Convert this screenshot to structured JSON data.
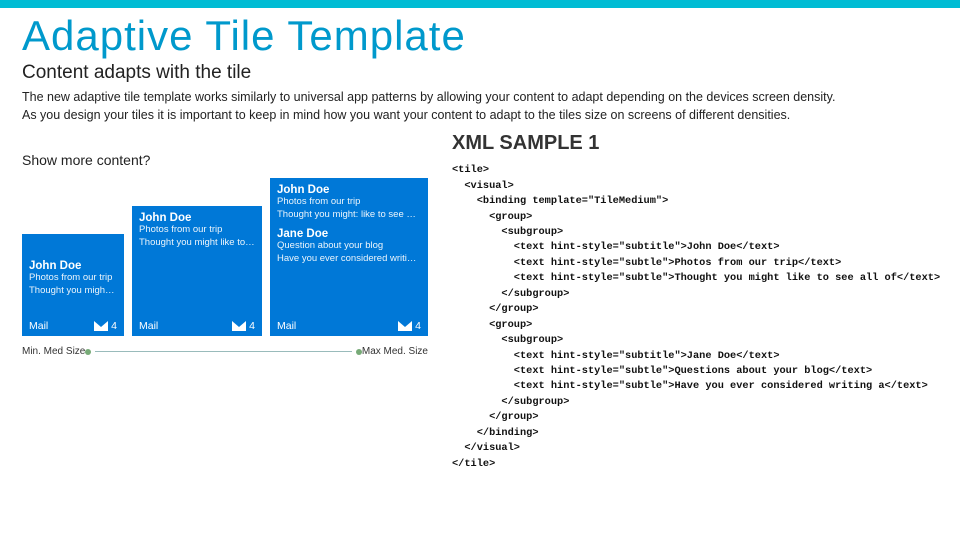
{
  "title": "Adaptive Tile Template",
  "subtitle": "Content adapts with the tile",
  "description": "The new adaptive tile template works similarly to universal app patterns by allowing your content to adapt depending on the devices screen density.\nAs you design your tiles it is important to keep in mind how you want your content to adapt to the tiles size on screens of different densities.",
  "showMore": "Show more content?",
  "xmlHeading": "XML SAMPLE 1",
  "sizer": {
    "min": "Min. Med Size",
    "max": "Max Med. Size"
  },
  "tiles": {
    "app": "Mail",
    "badge4": "4",
    "badge2a": "4",
    "badge2b": "4",
    "msgs": [
      {
        "name": "John Doe",
        "l1": "Photos from our trip",
        "l2": "Thought you might like to"
      },
      {
        "name": "John Doe",
        "l1": "Photos from our trip",
        "l2": "Thought you might like to see"
      },
      {
        "name": "John Doe",
        "l1": "Photos from our trip",
        "l2": "Thought you might: like to see all o"
      },
      {
        "name": "Jane Doe",
        "l1": "Question about your blog",
        "l2": "Have you ever considered writing a"
      }
    ]
  },
  "xml": "<tile>\n  <visual>\n    <binding template=\"TileMedium\">\n      <group>\n        <subgroup>\n          <text hint-style=\"subtitle\">John Doe</text>\n          <text hint-style=\"subtle\">Photos from our trip</text>\n          <text hint-style=\"subtle\">Thought you might like to see all of</text>\n        </subgroup>\n      </group>\n      <group>\n        <subgroup>\n          <text hint-style=\"subtitle\">Jane Doe</text>\n          <text hint-style=\"subtle\">Questions about your blog</text>\n          <text hint-style=\"subtle\">Have you ever considered writing a</text>\n        </subgroup>\n      </group>\n    </binding>\n  </visual>\n</tile>"
}
